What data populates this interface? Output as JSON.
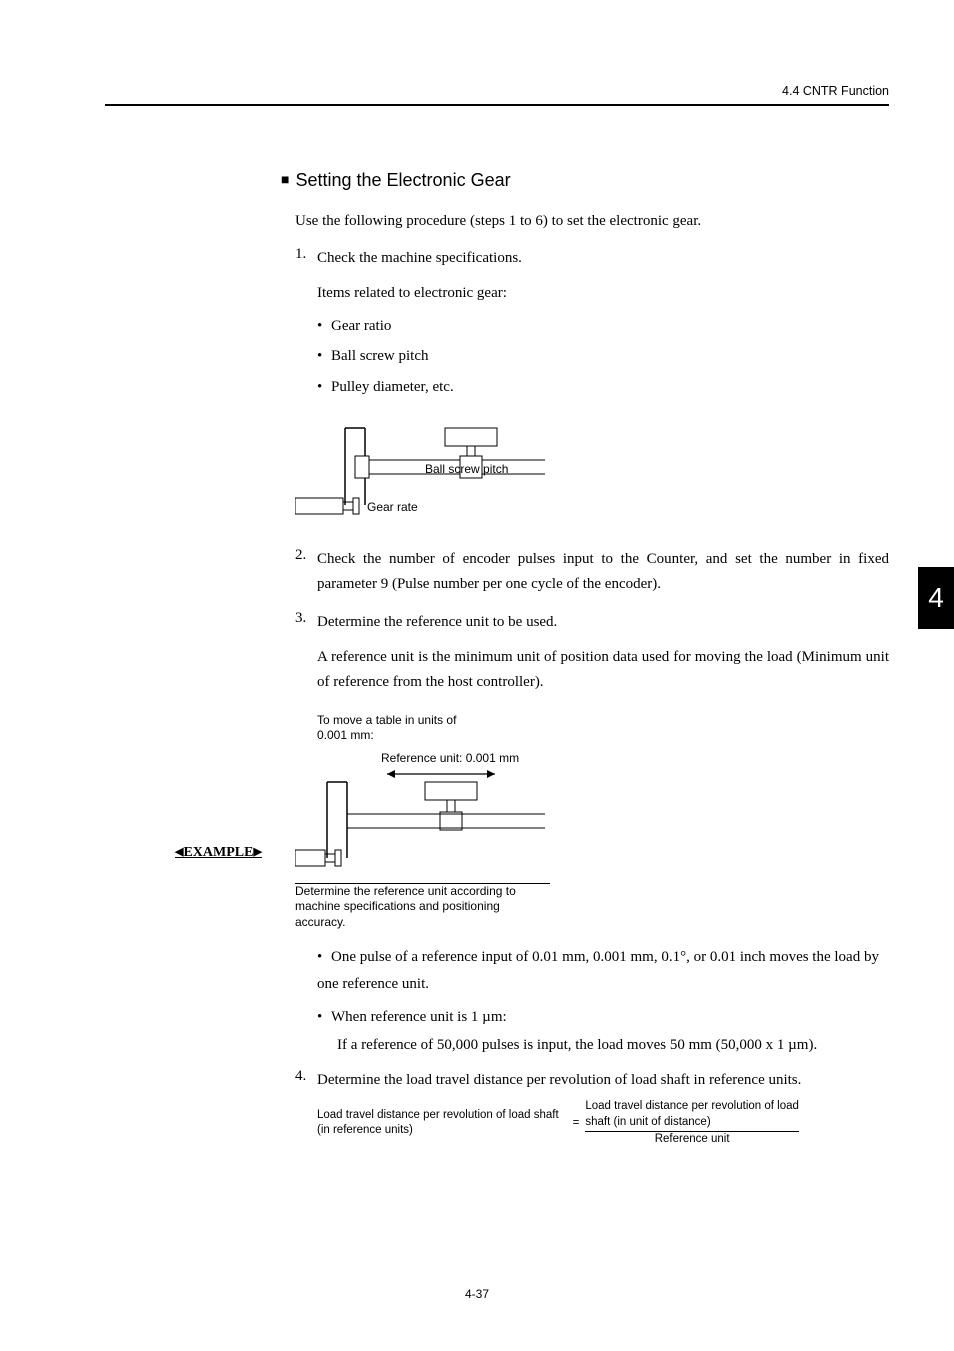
{
  "header": "4.4  CNTR Function",
  "section_heading": "Setting the Electronic Gear",
  "intro": "Use the following procedure (steps 1 to 6) to set the electronic gear.",
  "steps": {
    "s1": {
      "num": "1.",
      "text": "Check the machine specifications.",
      "items_intro": "Items related to electronic gear:",
      "bullets": {
        "b1": "Gear ratio",
        "b2": "Ball screw pitch",
        "b3": "Pulley diameter, etc."
      }
    },
    "s2": {
      "num": "2.",
      "text": "Check the number of encoder pulses input to the Counter, and set the number in fixed parameter 9 (Pulse number per one cycle of the encoder)."
    },
    "s3": {
      "num": "3.",
      "text": "Determine the reference unit to be used.",
      "text2": "A reference unit is the minimum unit of position data used for moving the load (Minimum unit of reference from the host controller)."
    },
    "s4": {
      "num": "4.",
      "text": "Determine the load travel distance per revolution of load shaft in reference units."
    }
  },
  "diagram1": {
    "label_pitch": "Ball screw pitch",
    "label_gear": "Gear rate"
  },
  "diagram2": {
    "caption_top1": "To move a table in units of",
    "caption_top2": "0.001 mm:",
    "label_ref": "Reference unit: 0.001 mm",
    "caption_bot1": "Determine the reference unit according to",
    "caption_bot2": "machine specifications and positioning",
    "caption_bot3": "accuracy."
  },
  "example": {
    "label": "EXAMPLE",
    "line1": "One pulse of a reference input of 0.01 mm, 0.001 mm, 0.1°, or 0.01 inch moves the load by one reference unit.",
    "line2": "When reference unit is 1 µm:",
    "line3": "If a reference of 50,000 pulses is input, the load moves 50 mm (50,000 x 1 µm)."
  },
  "formula": {
    "left1": "Load travel distance per revolution of load shaft",
    "left2": "(in reference units)",
    "eq": "=",
    "top1": "Load travel distance per revolution of load",
    "top2": "shaft (in unit of distance)",
    "bot": "Reference unit"
  },
  "thumb_tab": "4",
  "page_num": "4-37"
}
